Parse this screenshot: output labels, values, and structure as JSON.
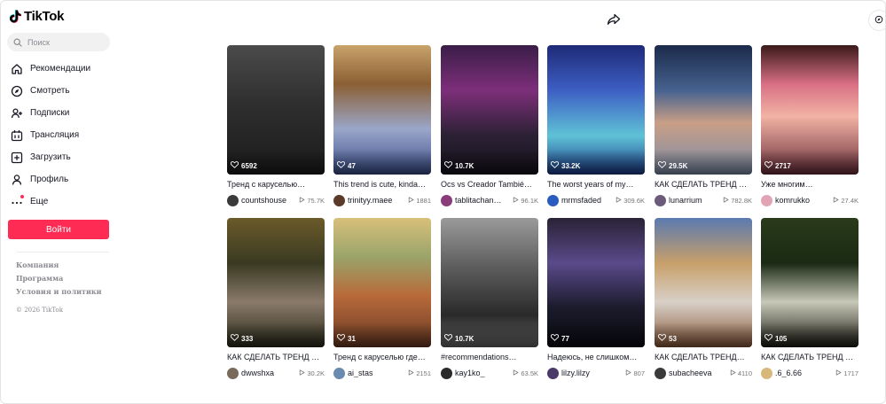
{
  "app": {
    "name": "TikTok"
  },
  "search": {
    "placeholder": "Поиск"
  },
  "nav": {
    "items": [
      {
        "label": "Рекомендации",
        "icon": "home-icon"
      },
      {
        "label": "Смотреть",
        "icon": "compass-icon"
      },
      {
        "label": "Подписки",
        "icon": "user-plus-icon"
      },
      {
        "label": "Трансляция",
        "icon": "live-icon"
      },
      {
        "label": "Загрузить",
        "icon": "upload-icon"
      },
      {
        "label": "Профиль",
        "icon": "profile-icon"
      },
      {
        "label": "Еще",
        "icon": "more-dots-icon"
      }
    ]
  },
  "login": {
    "label": "Войти"
  },
  "footer": {
    "links": [
      "Компания",
      "Программа",
      "Условия и политики"
    ],
    "copyright": "© 2026 TikTok"
  },
  "colors": {
    "accent": "#fe2c55"
  },
  "videos": [
    {
      "likes": "6592",
      "title": "Тренд с каруселью…",
      "user": "countshouse",
      "views": "75.7K",
      "thumb": "linear-gradient(180deg,#4b4b4b 0%,#2f2f2f 45%,#1b1b1b 100%)",
      "avatar": "#3a3a3a"
    },
    {
      "likes": "47",
      "title": "This trend is cute, kinda…",
      "user": "trinityy.maee",
      "views": "1881",
      "thumb": "linear-gradient(180deg,#c8a36a 0%,#8b5f34 30%,#9aa6c9 65%,#3b4f8c 100%)",
      "avatar": "#5b3a2a"
    },
    {
      "likes": "10.7K",
      "title": "Ocs vs Creador Tambié…",
      "user": "tablitachan…",
      "views": "96.1K",
      "thumb": "linear-gradient(180deg,#3a1d47 0%,#7d2f7a 35%,#2b2134 70%,#15121c 100%)",
      "avatar": "#8a3b7a"
    },
    {
      "likes": "33.2K",
      "title": "The worst years of my…",
      "user": "mrmsfaded",
      "views": "309.6K",
      "thumb": "linear-gradient(180deg,#1e2a77 0%,#3d5fc4 35%,#5fc2d6 70%,#1c3a8a 100%)",
      "avatar": "#2a5bbf"
    },
    {
      "likes": "29.5K",
      "title": "КАК СДЕЛАТЬ ТРЕНД …",
      "user": "lunarrium",
      "views": "782.8K",
      "thumb": "linear-gradient(180deg,#1b2a4a 0%,#46628f 35%,#c99f86 60%,#7c8ca8 100%)",
      "avatar": "#6b5a7a"
    },
    {
      "likes": "2717",
      "title": "Уже многим…",
      "user": "komrukko",
      "views": "27.4K",
      "thumb": "linear-gradient(180deg,#3a1a1a 0%,#d86f84 30%,#f2b3a4 55%,#6a2e3a 100%)",
      "avatar": "#e2a4b4"
    },
    {
      "likes": "333",
      "title": "КАК СДЕЛАТЬ ТРЕНД …",
      "user": "dwwshxa",
      "views": "30.2K",
      "thumb": "linear-gradient(180deg,#6b5a2a 0%,#3a3a22 35%,#8a7a6a 65%,#2a2a1a 100%)",
      "avatar": "#7a6a5a"
    },
    {
      "likes": "31",
      "title": "Тренд с каруселью где…",
      "user": "ai_stas",
      "views": "2151",
      "thumb": "linear-gradient(180deg,#d8c07a 0%,#9aa46a 30%,#b86a3a 60%,#6a3a24 100%)",
      "avatar": "#6a8ab0"
    },
    {
      "likes": "10.7K",
      "title": "#recommendations…",
      "user": "kay1ko_",
      "views": "63.5K",
      "thumb": "linear-gradient(180deg,#9a9a9a 0%,#5a5a5a 40%,#2a2a2a 75%,#6a6a6a 100%)",
      "avatar": "#2a2a2a"
    },
    {
      "likes": "77",
      "title": "Надеюсь, не слишком…",
      "user": "lilzy.lilzy",
      "views": "807",
      "thumb": "linear-gradient(180deg,#2a2236 0%,#5a4a8a 35%,#1a1a2a 70%,#0a0a12 100%)",
      "avatar": "#4a3a6a"
    },
    {
      "likes": "53",
      "title": "КАК СДЕЛАТЬ ТРЕНД…",
      "user": "subacheeva",
      "views": "4110",
      "thumb": "linear-gradient(180deg,#5a7ab0 0%,#c8a06a 35%,#d8d0c8 65%,#8a5a3a 100%)",
      "avatar": "#3a3a3a"
    },
    {
      "likes": "105",
      "title": "КАК СДЕЛАТЬ ТРЕНД …",
      "user": ".6_6.66",
      "views": "1717",
      "thumb": "linear-gradient(180deg,#2a3a1a 0%,#1a2a14 35%,#c8c8b8 65%,#1a1a12 100%)",
      "avatar": "#d8b87a"
    }
  ]
}
